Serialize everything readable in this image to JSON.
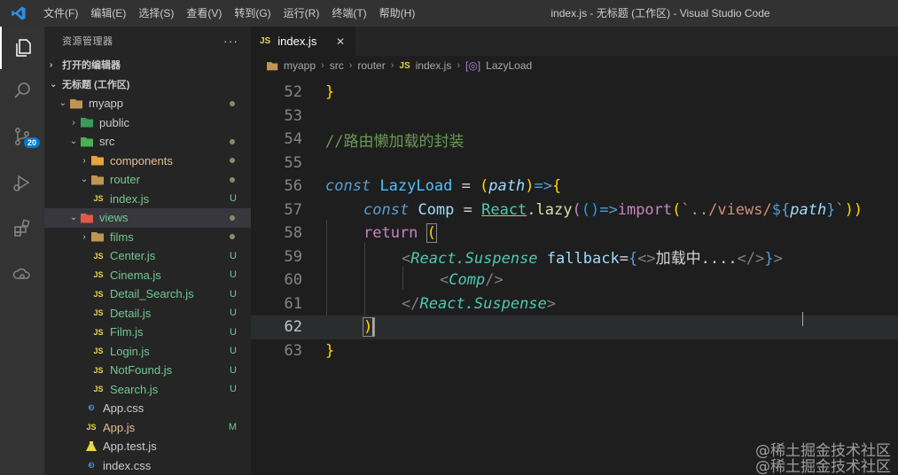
{
  "titlebar": {
    "menus": [
      "文件(F)",
      "编辑(E)",
      "选择(S)",
      "查看(V)",
      "转到(G)",
      "运行(R)",
      "终端(T)",
      "帮助(H)"
    ],
    "title": "index.js - 无标题 (工作区) - Visual Studio Code"
  },
  "activity": {
    "scm_badge": "20"
  },
  "sidebar": {
    "title": "资源管理器",
    "more": "···",
    "open_editors": "打开的编辑器",
    "workspace": "无标题 (工作区)",
    "tree": [
      {
        "label": "myapp",
        "status": "dot"
      },
      {
        "label": "public",
        "status": ""
      },
      {
        "label": "src",
        "status": "dot"
      },
      {
        "label": "components",
        "status": "dot"
      },
      {
        "label": "router",
        "status": "dot"
      },
      {
        "label": "index.js",
        "status": "U"
      },
      {
        "label": "views",
        "status": "dot"
      },
      {
        "label": "films",
        "status": "dot"
      },
      {
        "label": "Center.js",
        "status": "U"
      },
      {
        "label": "Cinema.js",
        "status": "U"
      },
      {
        "label": "Detail_Search.js",
        "status": "U"
      },
      {
        "label": "Detail.js",
        "status": "U"
      },
      {
        "label": "Film.js",
        "status": "U"
      },
      {
        "label": "Login.js",
        "status": "U"
      },
      {
        "label": "NotFound.js",
        "status": "U"
      },
      {
        "label": "Search.js",
        "status": "U"
      },
      {
        "label": "App.css",
        "status": ""
      },
      {
        "label": "App.js",
        "status": "M"
      },
      {
        "label": "App.test.js",
        "status": ""
      },
      {
        "label": "index.css",
        "status": ""
      }
    ],
    "js_badge": "JS"
  },
  "tabs": [
    {
      "label": "index.js",
      "close": "✕"
    }
  ],
  "breadcrumb": [
    "myapp",
    "src",
    "router",
    "index.js",
    "LazyLoad"
  ],
  "editor": {
    "line_numbers": [
      "52",
      "53",
      "54",
      "55",
      "56",
      "57",
      "58",
      "59",
      "60",
      "61",
      "62",
      "63"
    ],
    "l52": "}",
    "l54_comment": "//路由懒加载的封装",
    "l56": {
      "kw": "const",
      "name": "LazyLoad",
      "eq": " = ",
      "p1": "(",
      "arg": "path",
      "p2": ")",
      "arrow": "=>",
      "brace": "{"
    },
    "l57": {
      "kw": "const",
      "name": "Comp",
      "eq": " = ",
      "react": "React",
      "dot": ".",
      "fn": "lazy",
      "p1": "(",
      "p2": "()",
      "arrow": "=>",
      "imp": "import",
      "p3": "(",
      "tpl1": "`../views/",
      "tplOpen": "${",
      "tplVar": "path",
      "tplClose": "}",
      "tpl2": "`",
      "p4": "))"
    },
    "l58": {
      "kw": "return",
      "paren": "("
    },
    "l59": {
      "lt": "<",
      "tag": "React.Suspense",
      "attr": "fallback",
      "eq": "=",
      "b1": "{",
      "frag1": "<>",
      "text": "加载中....",
      "frag2": "</>",
      "b2": "}",
      "gt": ">"
    },
    "l60": {
      "lt": "<",
      "tag": "Comp",
      "end": "/>"
    },
    "l61": {
      "lt": "</",
      "tag": "React.Suspense",
      "gt": ">"
    },
    "l62": ")",
    "l63": "}"
  },
  "watermark": [
    "@稀土掘金技术社区",
    "@稀土掘金技术社区"
  ]
}
